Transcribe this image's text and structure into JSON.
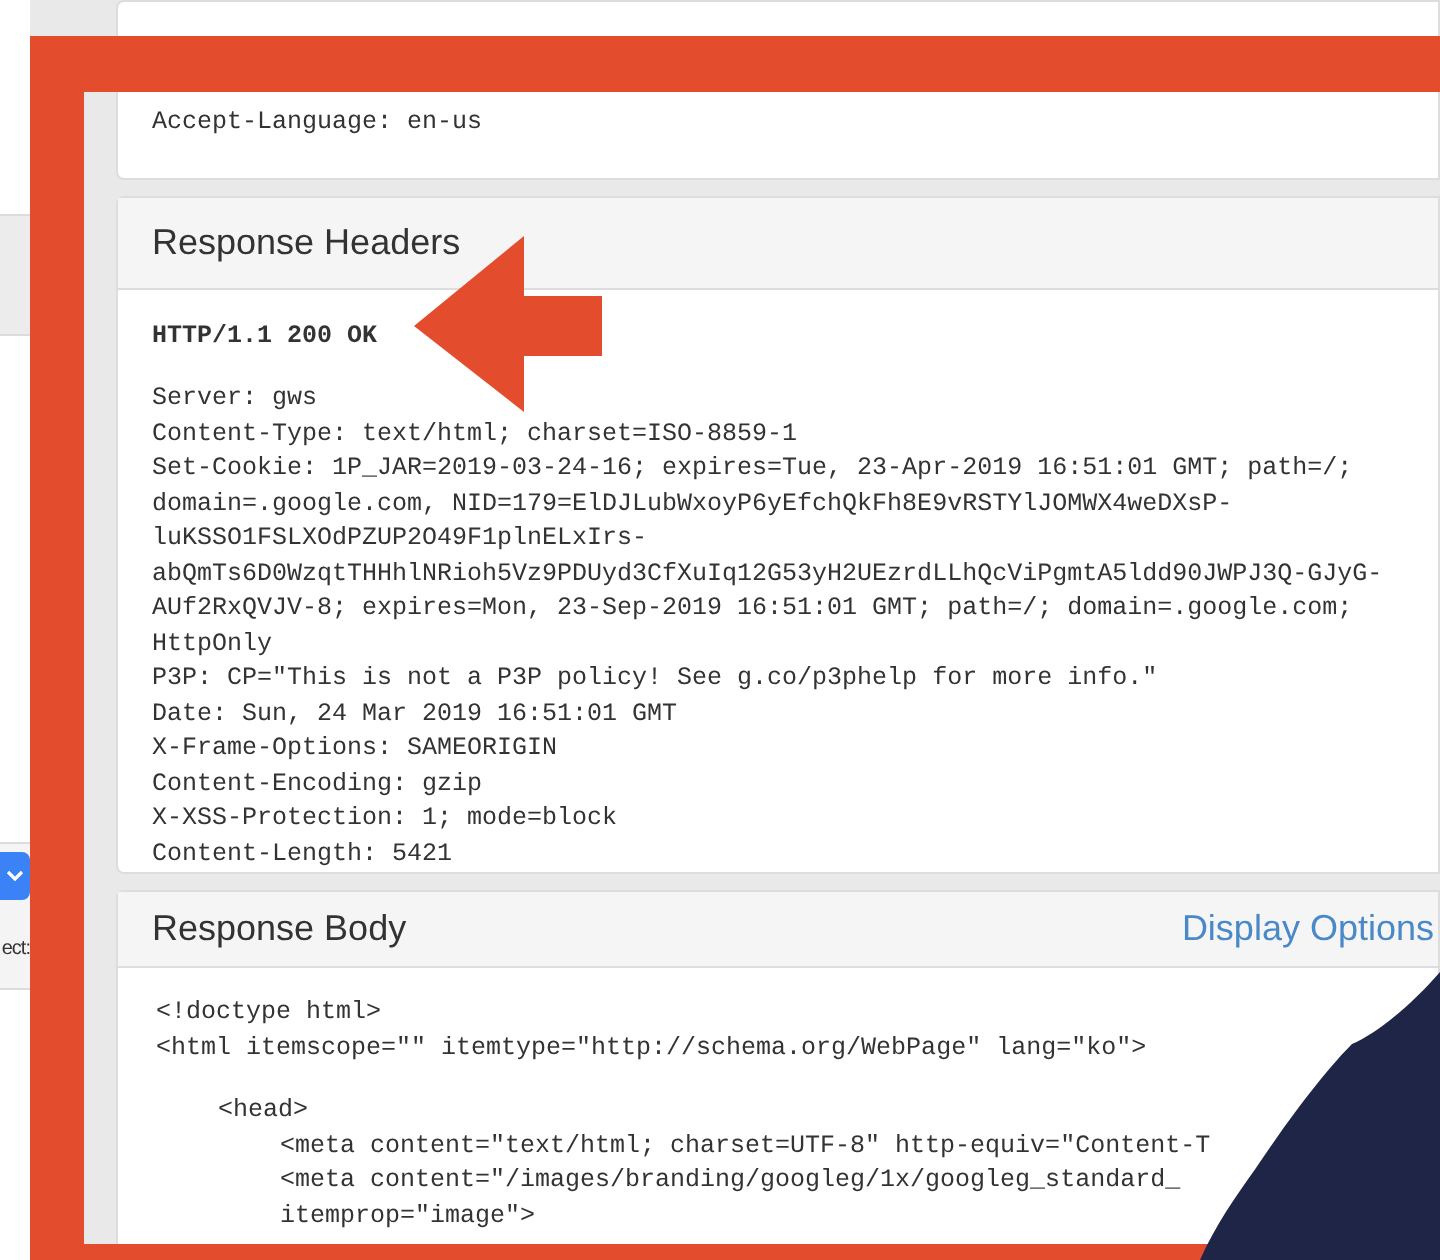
{
  "request_card": {
    "lines": [
      "Accept-Language: en-us"
    ]
  },
  "response_headers": {
    "title": "Response Headers",
    "status_line": "HTTP/1.1 200 OK",
    "lines": [
      "Server: gws",
      "Content-Type: text/html; charset=ISO-8859-1",
      "Set-Cookie: 1P_JAR=2019-03-24-16; expires=Tue, 23-Apr-2019 16:51:01 GMT; path=/;",
      "domain=.google.com, NID=179=ElDJLubWxoyP6yEfchQkFh8E9vRSTYlJOMWX4weDXsP-",
      "luKSSO1FSLXOdPZUP2O49F1plnELxIrs-",
      "abQmTs6D0WzqtTHHhlNRioh5Vz9PDUyd3CfXuIq12G53yH2UEzrdLLhQcViPgmtA5ldd90JWPJ3Q-GJyG-",
      "AUf2RxQVJV-8; expires=Mon, 23-Sep-2019 16:51:01 GMT; path=/; domain=.google.com;",
      "HttpOnly",
      "P3P: CP=\"This is not a P3P policy! See g.co/p3phelp for more info.\"",
      "Date: Sun, 24 Mar 2019 16:51:01 GMT",
      "X-Frame-Options: SAMEORIGIN",
      "Content-Encoding: gzip",
      "X-XSS-Protection: 1; mode=block",
      "Content-Length: 5421"
    ]
  },
  "response_body": {
    "title": "Response Body",
    "link": "Display Options",
    "lines": [
      {
        "text": "<!doctype html>"
      },
      {
        "text": "<html itemscope=\"\" itemtype=\"http://schema.org/WebPage\" lang=\"ko\">",
        "children": [
          {
            "text": "<head>",
            "children": [
              {
                "text": "<meta content=\"text/html; charset=UTF-8\" http-equiv=\"Content-T"
              },
              {
                "text": "<meta content=\"/images/branding/googleg/1x/googleg_standard_"
              },
              {
                "text": "itemprop=\"image\">"
              }
            ]
          }
        ]
      }
    ]
  },
  "sidebar": {
    "label": "ect:"
  }
}
